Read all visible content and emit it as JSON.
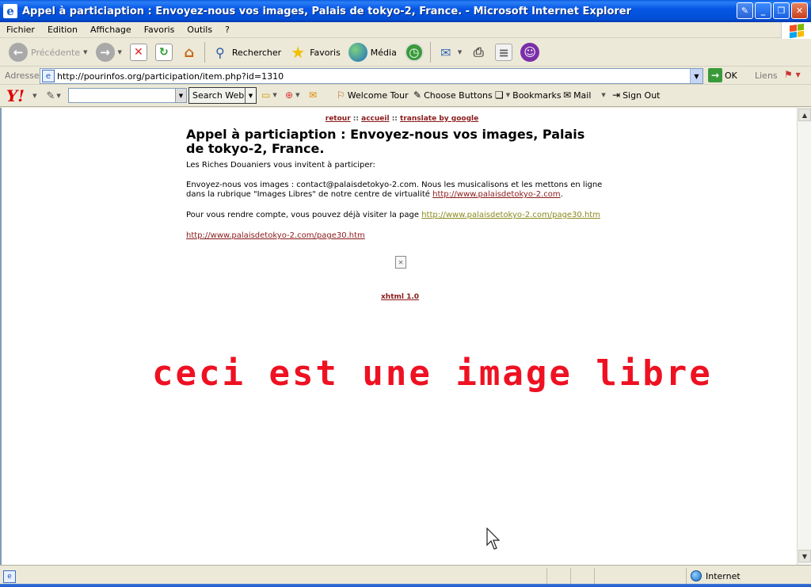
{
  "window": {
    "title": "Appel à particiaption : Envoyez-nous vos images, Palais de tokyo-2, France. - Microsoft Internet Explorer",
    "minimize": "_",
    "maximize": "❐",
    "close": "✕"
  },
  "menu": [
    "Fichier",
    "Edition",
    "Affichage",
    "Favoris",
    "Outils",
    "?"
  ],
  "toolbar": {
    "back": "Précédente",
    "search": "Rechercher",
    "favorites": "Favoris",
    "media": "Média"
  },
  "address": {
    "label": "Adresse",
    "url": "http://pourinfos.org/participation/item.php?id=1310",
    "go": "OK",
    "links": "Liens"
  },
  "yahoo": {
    "logo": "Y!",
    "search_button": "Search Web",
    "welcome_tour": "Welcome Tour",
    "choose_buttons": "Choose Buttons",
    "bookmarks": "Bookmarks",
    "mail": "Mail",
    "sign_out": "Sign Out"
  },
  "page": {
    "nav": {
      "retour": "retour",
      "sep": "::",
      "accueil": "accueil",
      "translate": "translate by google"
    },
    "title": "Appel à particiaption : Envoyez-nous vos images, Palais de tokyo-2, France.",
    "intro": "Les Riches Douaniers vous invitent à participer:",
    "para1_text": "Envoyez-nous vos images : contact@palaisdetokyo-2.com. Nous les musicalisons et les mettons en ligne dans la rubrique \"Images Libres\" de notre centre de virtualité ",
    "para1_link": "http://www.palaisdetokyo-2.com",
    "para1_end": ".",
    "para2_text": "Pour vous rendre compte, vous pouvez déjà visiter la page ",
    "para2_link": "http://www.palaisdetokyo-2.com/page30.htm",
    "para3_link": "http://www.palaisdetokyo-2.com/page30.htm",
    "xhtml": "xhtml 1.0",
    "big_text": "ceci est une image libre"
  },
  "status": {
    "zone": "Internet"
  },
  "colors": {
    "title_red": "#ee1122",
    "link": "#8b1a1a",
    "link_visited": "#8a8a20"
  }
}
